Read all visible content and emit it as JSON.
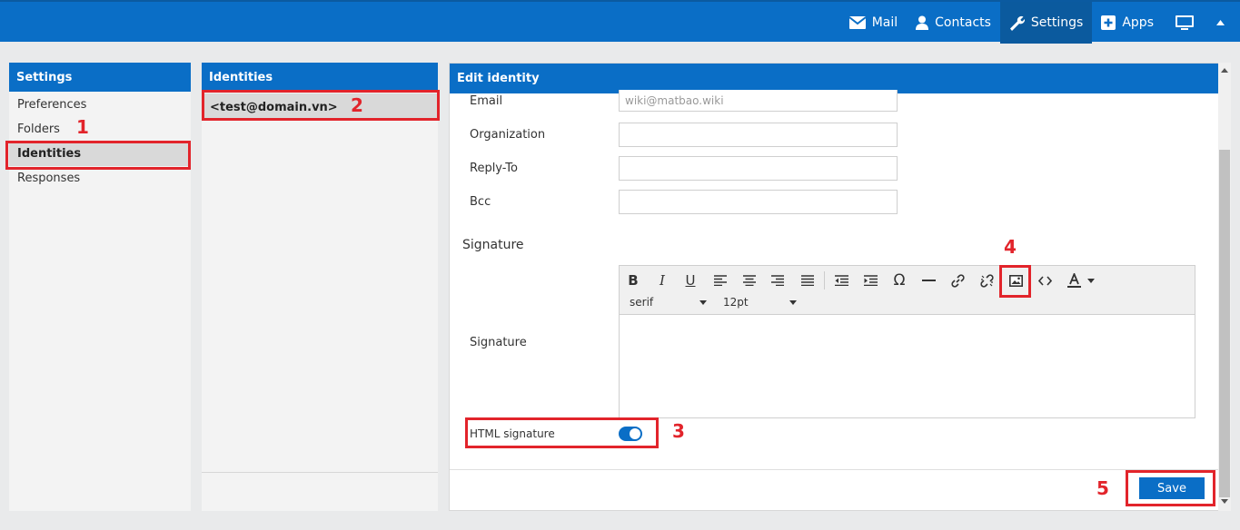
{
  "nav": {
    "mail": "Mail",
    "contacts": "Contacts",
    "settings": "Settings",
    "apps": "Apps"
  },
  "settings_panel": {
    "title": "Settings",
    "items": [
      "Preferences",
      "Folders",
      "Identities",
      "Responses"
    ],
    "selected": 2
  },
  "identities_panel": {
    "title": "Identities",
    "items": [
      "<test@domain.vn>"
    ]
  },
  "edit_panel": {
    "title": "Edit identity",
    "fields": [
      {
        "label": "Email",
        "value": "wiki@matbao.wiki"
      },
      {
        "label": "Organization",
        "value": ""
      },
      {
        "label": "Reply-To",
        "value": ""
      },
      {
        "label": "Bcc",
        "value": ""
      }
    ],
    "section_title": "Signature",
    "signature_label": "Signature",
    "font_family": "serif",
    "font_size": "12pt",
    "html_signature_label": "HTML signature",
    "html_signature_on": true,
    "save_label": "Save"
  },
  "annotations": [
    "1",
    "2",
    "3",
    "4",
    "5"
  ],
  "colors": {
    "accent": "#0a6ec6",
    "annotation": "#e2242b"
  }
}
